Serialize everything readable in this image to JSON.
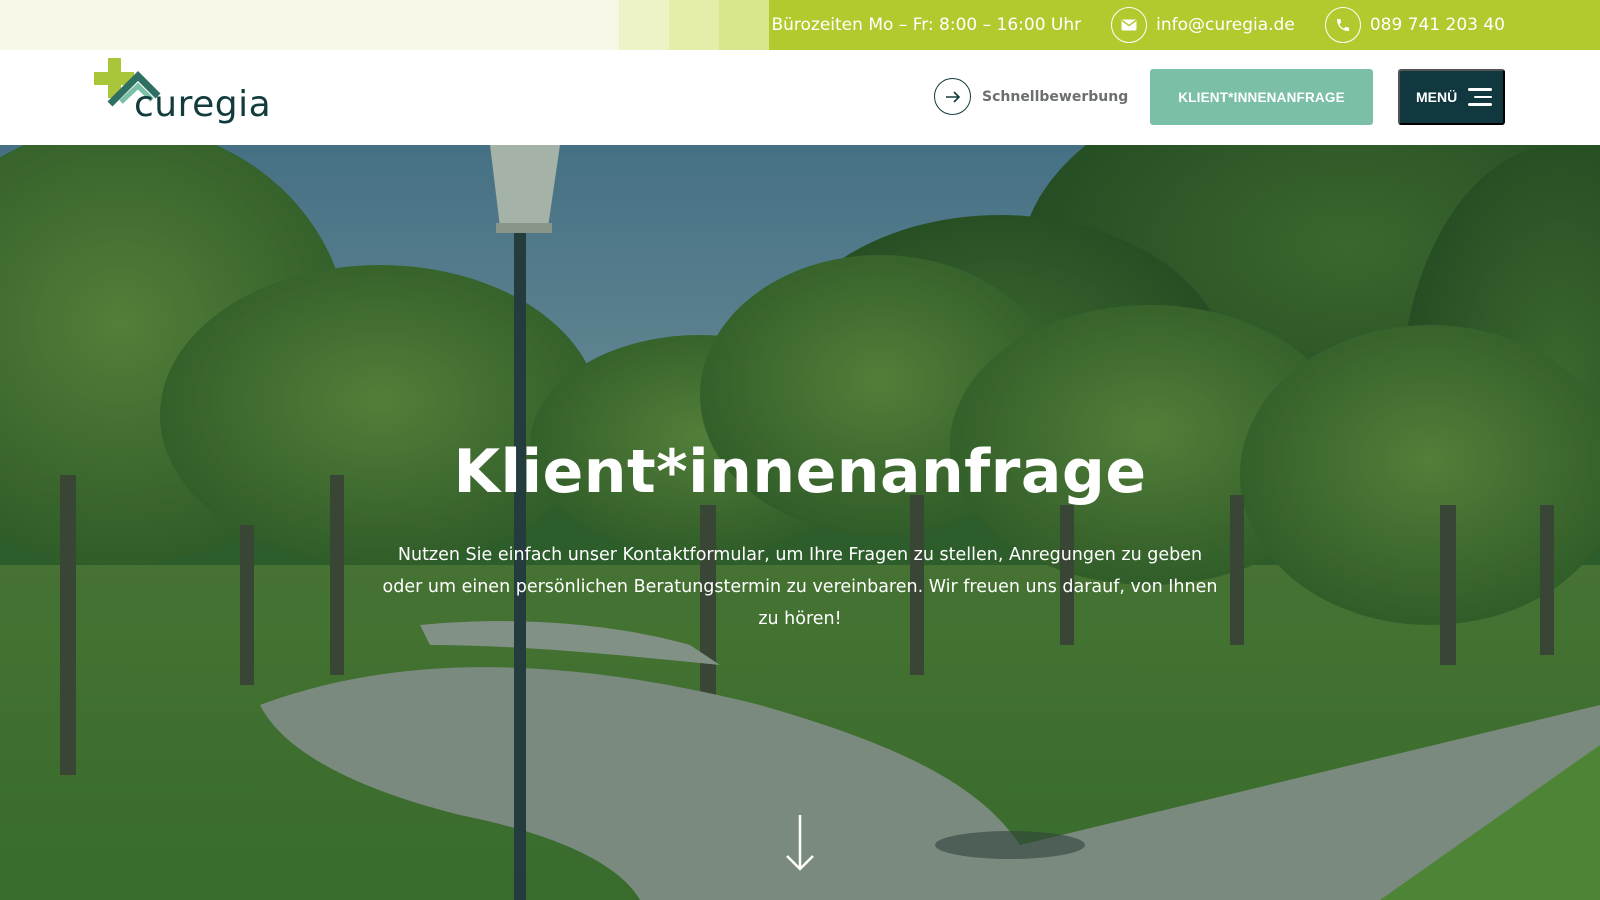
{
  "topbar": {
    "hours": "Bürozeiten Mo – Fr: 8:00 – 16:00 Uhr",
    "email": "info@curegia.de",
    "phone": "089 741 203 40",
    "email_icon": "mail-icon",
    "phone_icon": "phone-icon"
  },
  "header": {
    "logo_text": "curegia",
    "quick_apply_label": "Schnellbewerbung",
    "request_button": "KLIENT*INNENANFRAGE",
    "menu_label": "MENÜ"
  },
  "hero": {
    "title": "Klient*innenanfrage",
    "text": "Nutzen Sie einfach unser Kontaktformular, um Ihre Fragen zu stellen, Anregungen zu geben oder um einen persönlichen Beratungstermin zu vereinbaren. Wir freuen uns darauf, von Ihnen zu hören!"
  },
  "colors": {
    "lime": "#b3ca2e",
    "mint": "#7bbfa7",
    "dark_teal": "#11383f"
  }
}
